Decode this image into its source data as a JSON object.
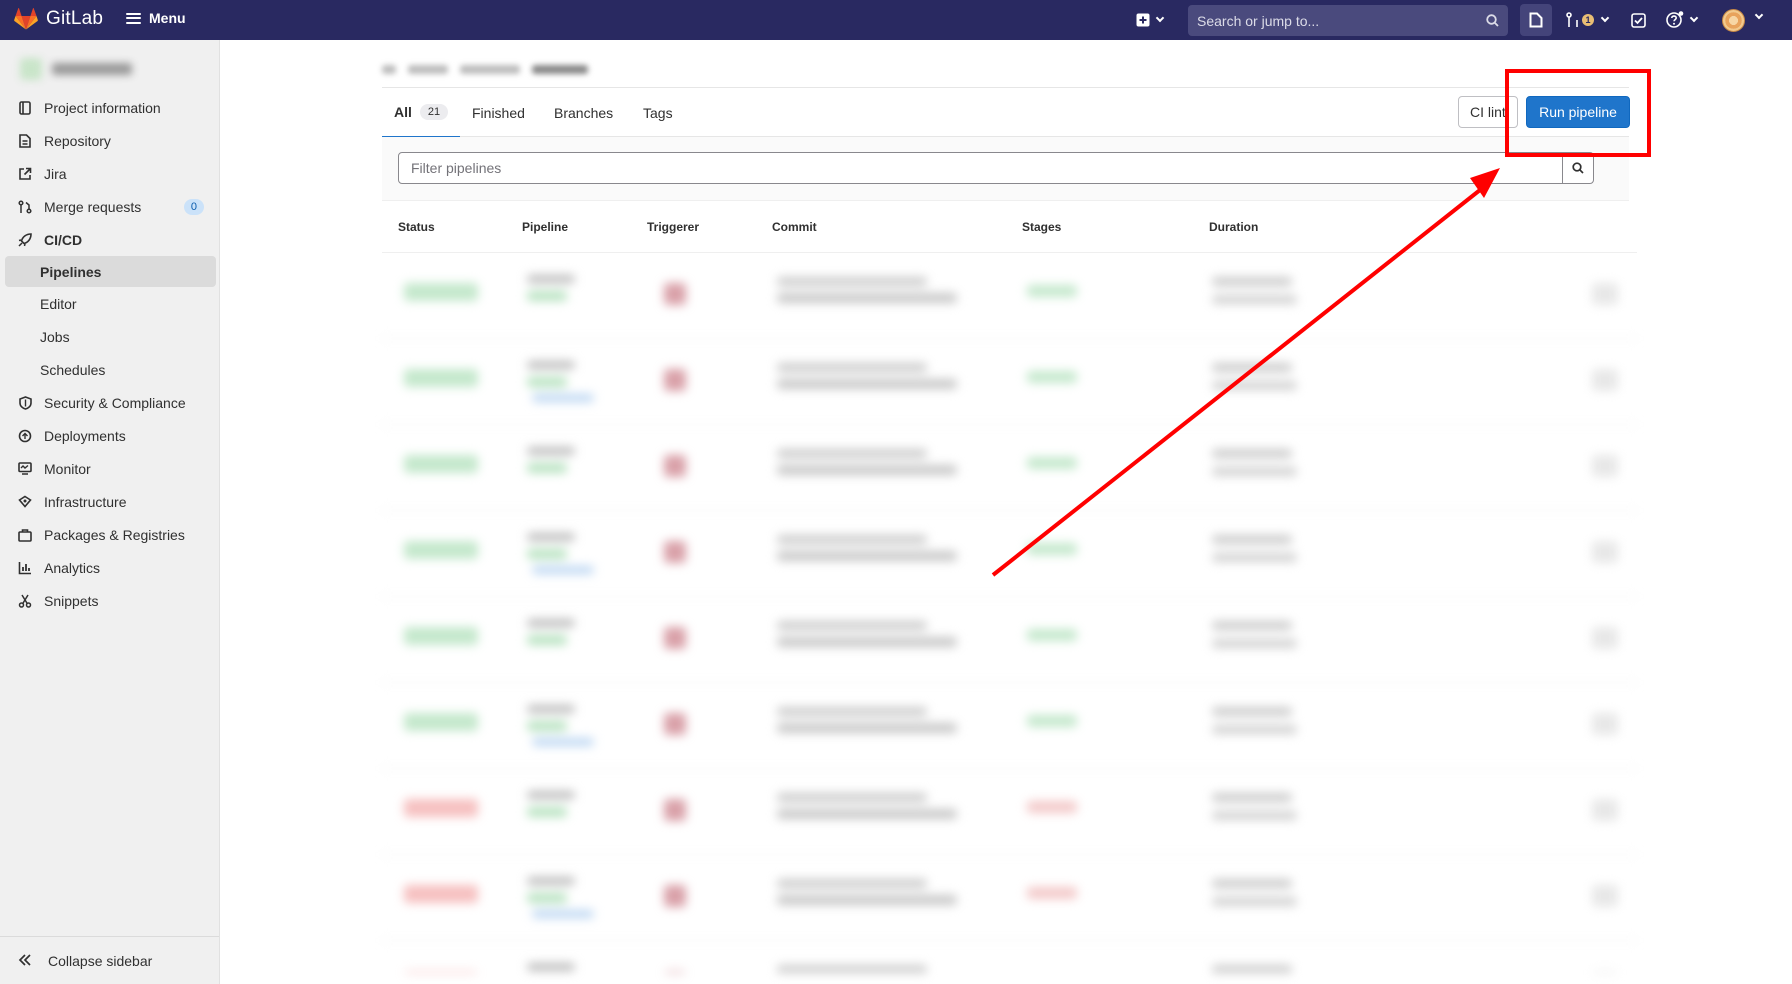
{
  "topbar": {
    "brand": "GitLab",
    "menu_label": "Menu",
    "search_placeholder": "Search or jump to...",
    "mr_count": "1",
    "bg_color": "#292961"
  },
  "sidebar": {
    "items": [
      {
        "label": "Project information",
        "icon": "project-icon"
      },
      {
        "label": "Repository",
        "icon": "document-icon"
      },
      {
        "label": "Jira",
        "icon": "external-link-icon"
      },
      {
        "label": "Merge requests",
        "icon": "merge-request-icon",
        "count": "0"
      },
      {
        "label": "CI/CD",
        "icon": "rocket-icon"
      },
      {
        "label": "Security & Compliance",
        "icon": "shield-icon"
      },
      {
        "label": "Deployments",
        "icon": "deployments-icon"
      },
      {
        "label": "Monitor",
        "icon": "monitor-icon"
      },
      {
        "label": "Infrastructure",
        "icon": "cloud-icon"
      },
      {
        "label": "Packages & Registries",
        "icon": "package-icon"
      },
      {
        "label": "Analytics",
        "icon": "chart-icon"
      },
      {
        "label": "Snippets",
        "icon": "snippet-icon"
      }
    ],
    "cicd_sub": [
      "Pipelines",
      "Editor",
      "Jobs",
      "Schedules"
    ],
    "collapse_label": "Collapse sidebar"
  },
  "tabs": [
    {
      "label": "All",
      "count": "21"
    },
    {
      "label": "Finished"
    },
    {
      "label": "Branches"
    },
    {
      "label": "Tags"
    }
  ],
  "buttons": {
    "ci_lint": "CI lint",
    "run_pipeline": "Run pipeline"
  },
  "filter": {
    "placeholder": "Filter pipelines"
  },
  "table": {
    "headers": [
      "Status",
      "Pipeline",
      "Triggerer",
      "Commit",
      "Stages",
      "Duration"
    ]
  },
  "colors": {
    "accent": "#1f75cb",
    "annotation": "#ff0000"
  }
}
